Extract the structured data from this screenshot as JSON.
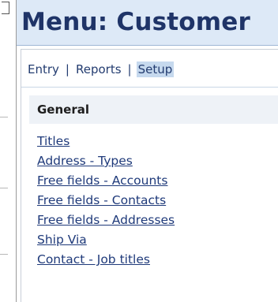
{
  "title": "Menu: Customer",
  "tabs": [
    {
      "label": "Entry",
      "active": false
    },
    {
      "label": "Reports",
      "active": false
    },
    {
      "label": "Setup",
      "active": true
    }
  ],
  "tab_separator": "|",
  "section": {
    "title": "General",
    "links": [
      "Titles",
      "Address - Types",
      "Free fields - Accounts",
      "Free fields - Contacts",
      "Free fields - Addresses",
      "Ship Via",
      "Contact - Job titles"
    ]
  },
  "colors": {
    "title_bg": "#dde9f7",
    "title_text": "#1f3468",
    "link": "#1f3a7a",
    "active_tab_bg": "#c6d9ee",
    "section_bg": "#eef2f7"
  }
}
